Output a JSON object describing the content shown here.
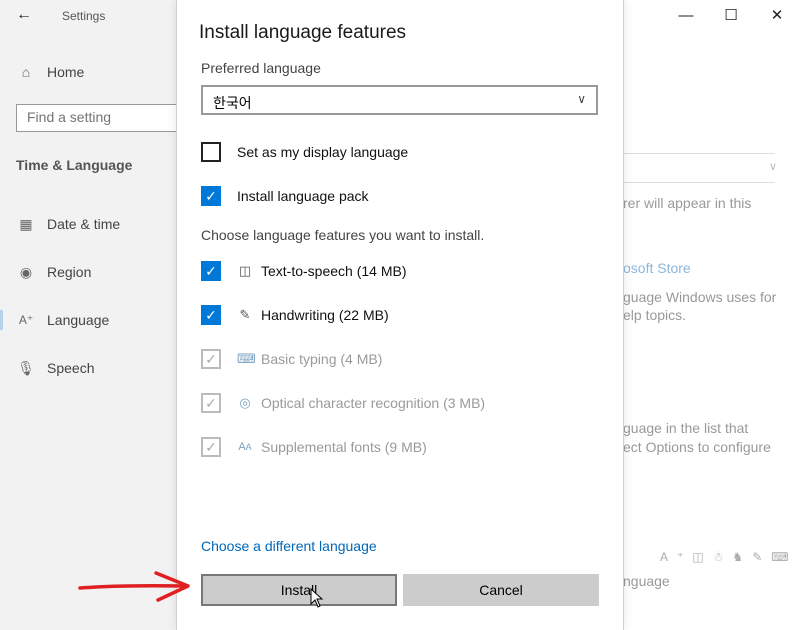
{
  "settings_window": {
    "title": "Settings",
    "back_icon": "back-arrow-icon",
    "nav_home": "Home",
    "search_placeholder": "Find a setting",
    "section_title": "Time & Language",
    "nav_items": [
      {
        "label": "Date & time",
        "icon": "calendar-clock-icon"
      },
      {
        "label": "Region",
        "icon": "globe-icon"
      },
      {
        "label": "Language",
        "icon": "language-icon",
        "active": true
      },
      {
        "label": "Speech",
        "icon": "microphone-icon"
      }
    ],
    "window_controls": [
      "minimize-icon",
      "maximize-icon",
      "close-icon"
    ],
    "background_text": {
      "line1": "rer will appear in this",
      "link": "osoft Store",
      "line2": "guage Windows uses for",
      "line3": "elp topics.",
      "line4": "guage in the list that",
      "line5": "ect Options to configure",
      "line6": "nguage"
    }
  },
  "dialog": {
    "title": "Install language features",
    "preferred_label": "Preferred language",
    "preferred_value": "한국어",
    "display_language": {
      "label": "Set as my display language",
      "checked": false
    },
    "language_pack": {
      "label": "Install language pack",
      "checked": true
    },
    "choose_label": "Choose language features you want to install.",
    "features": [
      {
        "label": "Text-to-speech (14 MB)",
        "checked": true,
        "enabled": true,
        "icon": "speech-icon"
      },
      {
        "label": "Handwriting (22 MB)",
        "checked": true,
        "enabled": true,
        "icon": "pen-icon"
      },
      {
        "label": "Basic typing (4 MB)",
        "checked": true,
        "enabled": false,
        "icon": "keyboard-icon"
      },
      {
        "label": "Optical character recognition (3 MB)",
        "checked": true,
        "enabled": false,
        "icon": "camera-icon"
      },
      {
        "label": "Supplemental fonts (9 MB)",
        "checked": true,
        "enabled": false,
        "icon": "font-icon"
      }
    ],
    "different_language_link": "Choose a different language",
    "install_button": "Install",
    "cancel_button": "Cancel"
  },
  "annotation": {
    "arrow_color": "#e02020"
  }
}
